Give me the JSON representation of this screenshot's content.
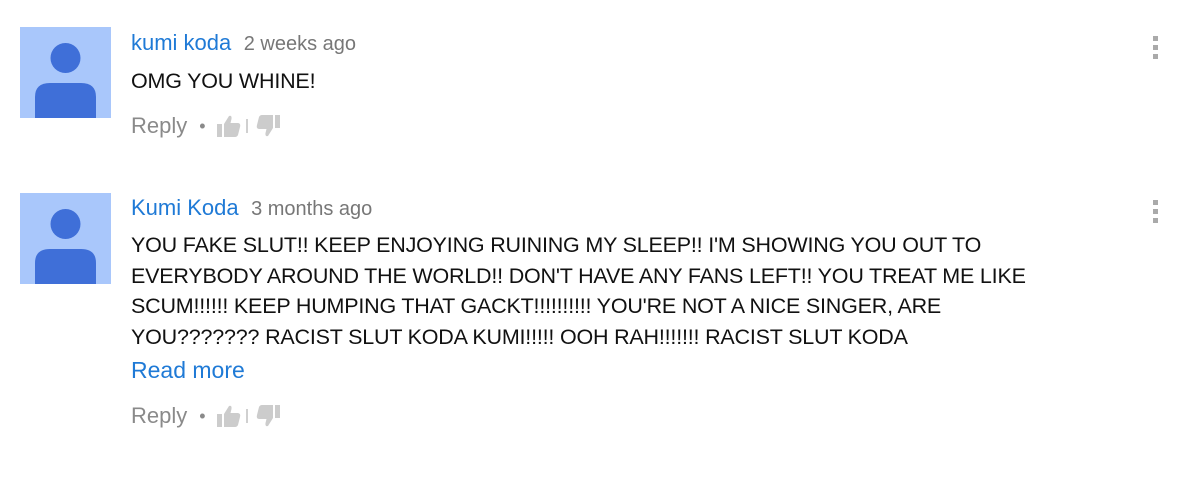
{
  "comments": [
    {
      "author": "kumi koda",
      "time": "2 weeks ago",
      "text": "OMG YOU WHINE!",
      "reply_label": "Reply",
      "separator": "•"
    },
    {
      "author": "Kumi Koda",
      "time": "3 months ago",
      "text": "YOU FAKE SLUT!!  KEEP ENJOYING RUINING MY SLEEP!!  I'M SHOWING YOU OUT TO\nEVERYBODY AROUND THE WORLD!!  DON'T HAVE ANY FANS LEFT!!  YOU TREAT ME LIKE\nSCUM!!!!!!  KEEP HUMPING THAT GACKT!!!!!!!!!!  YOU'RE NOT A NICE SINGER, ARE\nYOU???????  RACIST SLUT KODA KUMI!!!!!  OOH RAH!!!!!!!  RACIST SLUT KODA",
      "read_more": "Read more",
      "reply_label": "Reply",
      "separator": "•"
    }
  ],
  "icons": {
    "avatar": "default-user-icon",
    "like": "thumbs-up-icon",
    "dislike": "thumbs-down-icon",
    "menu": "more-vertical-icon"
  },
  "colors": {
    "author": "#1f7ad6",
    "avatar_bg": "#a9c7fb",
    "avatar_figure": "#3f6fd8",
    "muted": "#8a8a8a",
    "icon": "#cccccc"
  }
}
